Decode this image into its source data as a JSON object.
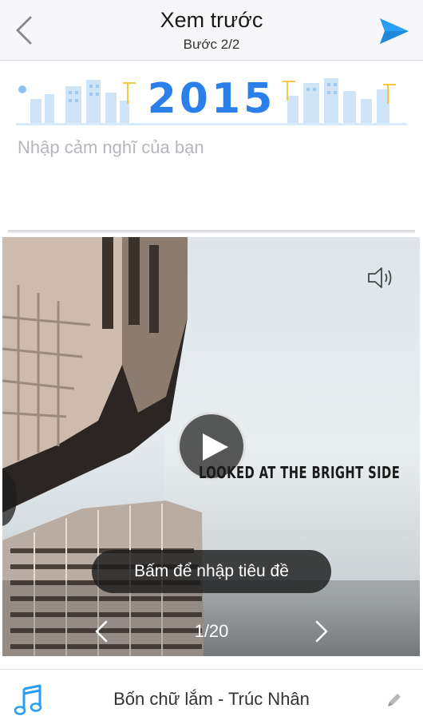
{
  "header": {
    "title": "Xem trước",
    "subtitle": "Bước 2/2",
    "back_icon": "chevron-left-icon",
    "send_icon": "send-icon",
    "accent_color": "#2a9df4"
  },
  "banner": {
    "year_text": "2015"
  },
  "composer": {
    "placeholder": "Nhập cảm nghĩ của bạn",
    "value": ""
  },
  "media": {
    "caption": "LOOKED AT THE BRIGHT SIDE",
    "title_button": "Bấm để nhập tiêu đề",
    "counter": "1/20",
    "speaker_icon": "speaker-icon",
    "play_icon": "play-icon",
    "prev_icon": "chevron-left-icon",
    "next_icon": "chevron-right-icon"
  },
  "music": {
    "song": "Bốn chữ lắm - Trúc Nhân",
    "music_icon": "music-note-icon",
    "edit_icon": "pencil-icon"
  }
}
